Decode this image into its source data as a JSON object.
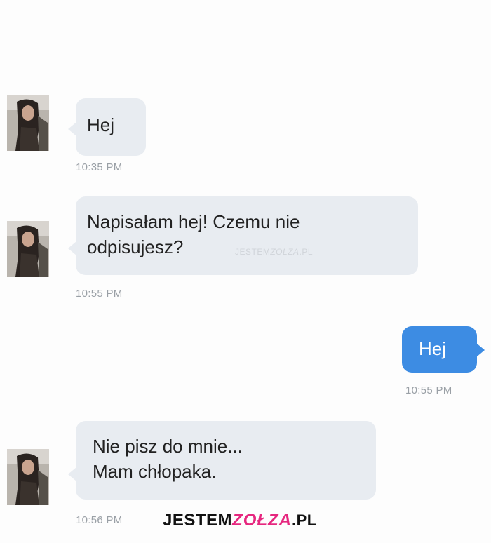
{
  "messages": [
    {
      "direction": "incoming",
      "lines": [
        "Hej"
      ],
      "time": "10:35 PM"
    },
    {
      "direction": "incoming",
      "lines": [
        "Napisałam hej! Czemu nie",
        "odpisujesz?"
      ],
      "time": "10:55 PM"
    },
    {
      "direction": "outgoing",
      "lines": [
        "Hej"
      ],
      "time": "10:55 PM"
    },
    {
      "direction": "incoming",
      "lines": [
        "Nie pisz do mnie...",
        "Mam chłopaka."
      ],
      "time": "10:56 PM"
    }
  ],
  "watermark_inline": {
    "prefix": "JESTEM",
    "middle": "ZOLZA",
    "suffix": ".PL"
  },
  "watermark": {
    "prefix": "JESTEM",
    "brand": "ZOŁZA",
    "suffix": ".PL"
  },
  "colors": {
    "incoming_bubble": "#e8ecf1",
    "outgoing_bubble": "#3d8ce3",
    "brand_pink": "#e6277f",
    "timestamp": "#9aa0a6"
  },
  "icons": {
    "avatar": "contact-avatar-photo"
  }
}
